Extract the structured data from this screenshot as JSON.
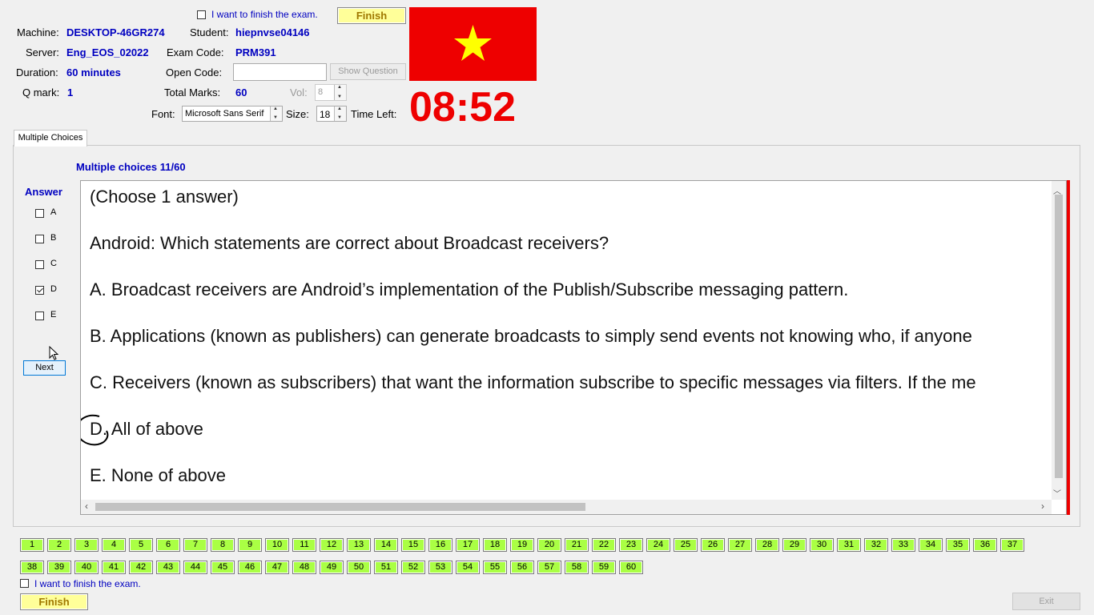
{
  "header": {
    "finish_check_label": "I want to finish the exam.",
    "finish_button": "Finish",
    "machine_label": "Machine:",
    "machine_value": "DESKTOP-46GR274",
    "student_label": "Student:",
    "student_value": "hiepnvse04146",
    "server_label": "Server:",
    "server_value": "Eng_EOS_02022",
    "exam_code_label": "Exam Code:",
    "exam_code_value": "PRM391",
    "duration_label": "Duration:",
    "duration_value": "60 minutes",
    "open_code_label": "Open Code:",
    "open_code_value": "",
    "show_question_button": "Show Question",
    "qmark_label": "Q mark:",
    "qmark_value": "1",
    "total_marks_label": "Total Marks:",
    "total_marks_value": "60",
    "vol_label": "Vol:",
    "vol_value": "8",
    "font_label": "Font:",
    "font_value": "Microsoft Sans Serif",
    "size_label": "Size:",
    "size_value": "18",
    "time_left_label": "Time Left:",
    "timer": "08:52",
    "flag_colors": {
      "field": "#ee0000",
      "star": "#ffff00"
    }
  },
  "tab": {
    "label": "Multiple Choices"
  },
  "main": {
    "progress": "Multiple choices 11/60",
    "answer_title": "Answer",
    "options": [
      {
        "label": "A",
        "checked": false
      },
      {
        "label": "B",
        "checked": false
      },
      {
        "label": "C",
        "checked": false
      },
      {
        "label": "D",
        "checked": true
      },
      {
        "label": "E",
        "checked": false
      }
    ],
    "next_button": "Next"
  },
  "question": {
    "lines": [
      "(Choose 1 answer)",
      "Android: Which statements are correct about Broadcast receivers?",
      "A.  Broadcast receivers are Android’s implementation of the Publish/Subscribe messaging pattern.",
      "B.  Applications (known as publishers) can generate broadcasts to simply send events not knowing who, if anyone",
      "C.  Receivers (known as subscribers) that want the information subscribe to specific messages via filters. If the me",
      "D.  All of above",
      "E.  None of above"
    ]
  },
  "navigator": {
    "row1": [
      "1",
      "2",
      "3",
      "4",
      "5",
      "6",
      "7",
      "8",
      "9",
      "10",
      "11",
      "12",
      "13",
      "14",
      "15",
      "16",
      "17",
      "18",
      "19",
      "20",
      "21",
      "22",
      "23",
      "24",
      "25",
      "26",
      "27",
      "28",
      "29",
      "30",
      "31",
      "32",
      "33",
      "34",
      "35",
      "36",
      "37"
    ],
    "row2": [
      "38",
      "39",
      "40",
      "41",
      "42",
      "43",
      "44",
      "45",
      "46",
      "47",
      "48",
      "49",
      "50",
      "51",
      "52",
      "53",
      "54",
      "55",
      "56",
      "57",
      "58",
      "59",
      "60"
    ],
    "button_color": "#aaff44"
  },
  "footer": {
    "finish_check_label": "I want to finish the exam.",
    "finish_button": "Finish",
    "exit_button": "Exit"
  }
}
